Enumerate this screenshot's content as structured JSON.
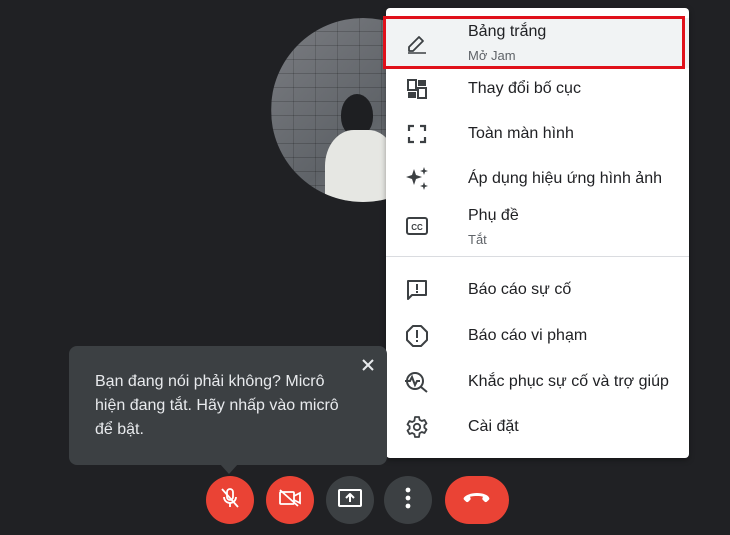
{
  "menu": {
    "items": [
      {
        "label": "Bảng trắng",
        "sublabel": "Mở Jam",
        "icon": "pencil-icon"
      },
      {
        "label": "Thay đổi bố cục",
        "icon": "layout-icon"
      },
      {
        "label": "Toàn màn hình",
        "icon": "fullscreen-icon"
      },
      {
        "label": "Áp dụng hiệu ứng hình ảnh",
        "icon": "sparkle-icon"
      },
      {
        "label": "Phụ đề",
        "sublabel": "Tắt",
        "icon": "closed-captions-icon"
      },
      {
        "label": "Báo cáo sự cố",
        "icon": "feedback-icon"
      },
      {
        "label": "Báo cáo vi phạm",
        "icon": "report-icon"
      },
      {
        "label": "Khắc phục sự cố và trợ giúp",
        "icon": "troubleshoot-icon"
      },
      {
        "label": "Cài đặt",
        "icon": "gear-icon"
      }
    ],
    "highlight_color": "#e0101a"
  },
  "tooltip": {
    "text": "Bạn đang nói phải không? Micrô hiện đang tắt. Hãy nhấp vào micrô để bật."
  },
  "controls": [
    {
      "icon": "mic-off-icon",
      "color": "#ea4335"
    },
    {
      "icon": "camera-off-icon",
      "color": "#ea4335"
    },
    {
      "icon": "present-screen-icon",
      "color": "#3c4043"
    },
    {
      "icon": "more-options-icon",
      "color": "#3c4043"
    },
    {
      "icon": "end-call-icon",
      "color": "#ea4335"
    }
  ],
  "colors": {
    "background": "#202124",
    "danger": "#ea4335",
    "control_gray": "#3c4043"
  }
}
